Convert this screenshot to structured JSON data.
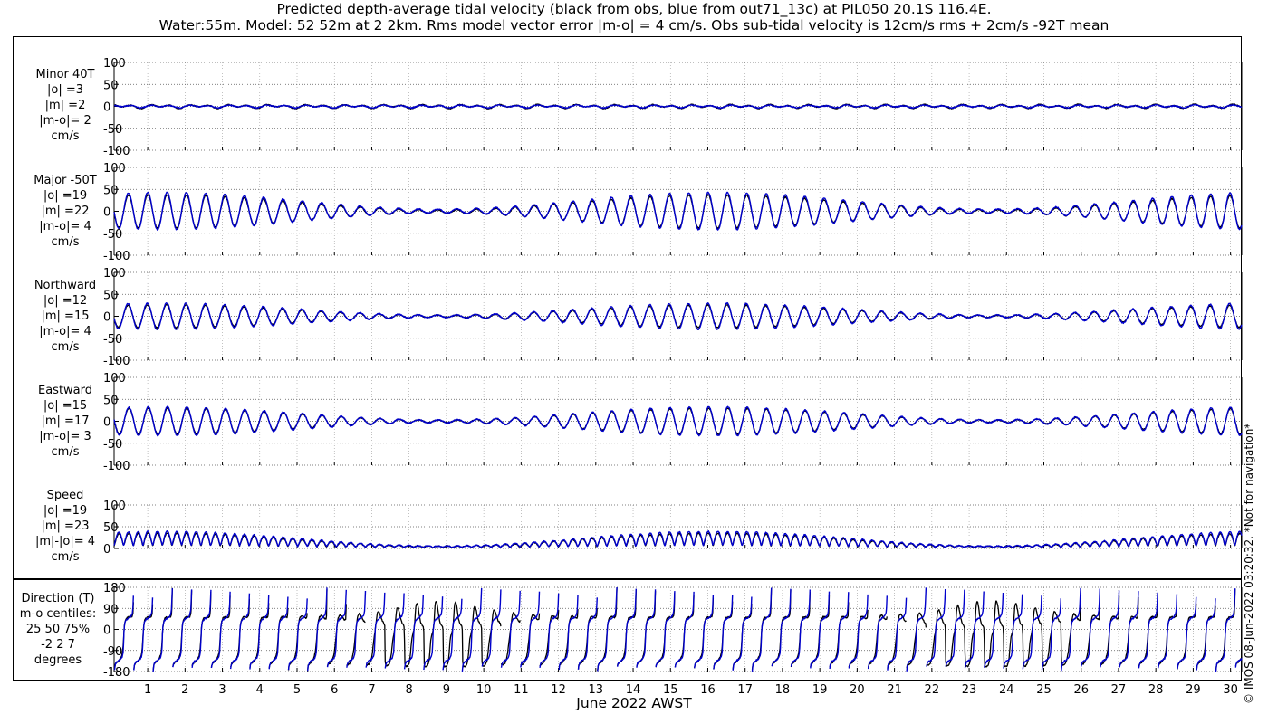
{
  "title": {
    "line1": "Predicted depth-average tidal velocity (black from obs, blue from out71_13c) at PIL050 20.1S 116.4E.",
    "line2": "Water:55m. Model: 52 52m at 2 2km. Rms model vector error |m-o| = 4 cm/s. Obs sub-tidal velocity is 12cm/s rms + 2cm/s -92T mean"
  },
  "xlabel": "June 2022 AWST",
  "credit": "© IMOS 08-Jun-2022 03:20:32. *Not for navigation*",
  "colors": {
    "obs": "#000000",
    "model": "#0000cc",
    "grid": "#999999",
    "axis": "#000000"
  },
  "chart_data": [
    {
      "type": "line",
      "panel": "minor",
      "label_lines": [
        "Minor 40T",
        "|o| =3",
        "|m| =2",
        "|m-o|= 2",
        "cm/s"
      ],
      "ylim": [
        -100,
        100
      ],
      "yticks": [
        -100,
        -50,
        0,
        50,
        100
      ],
      "xlim": [
        0.1,
        30.3
      ],
      "xticks": [
        1,
        2,
        3,
        4,
        5,
        6,
        7,
        8,
        9,
        10,
        11,
        12,
        13,
        14,
        15,
        16,
        17,
        18,
        19,
        20,
        21,
        22,
        23,
        24,
        25,
        26,
        27,
        28,
        29,
        30
      ],
      "grid": true,
      "series": [
        {
          "role": "obs",
          "stats": {
            "rms": 3
          }
        },
        {
          "role": "model",
          "stats": {
            "rms": 2
          }
        }
      ]
    },
    {
      "type": "line",
      "panel": "major",
      "label_lines": [
        "Major -50T",
        "|o| =19",
        "|m| =22",
        "|m-o|= 4",
        "cm/s"
      ],
      "ylim": [
        -100,
        100
      ],
      "yticks": [
        -100,
        -50,
        0,
        50,
        100
      ],
      "xlim": [
        0.1,
        30.3
      ],
      "grid": true,
      "series": [
        {
          "role": "obs",
          "stats": {
            "rms": 19
          }
        },
        {
          "role": "model",
          "stats": {
            "rms": 22
          }
        }
      ]
    },
    {
      "type": "line",
      "panel": "northward",
      "label_lines": [
        "Northward",
        "|o| =12",
        "|m| =15",
        "|m-o|= 4",
        "cm/s"
      ],
      "ylim": [
        -100,
        100
      ],
      "yticks": [
        -100,
        -50,
        0,
        50,
        100
      ],
      "xlim": [
        0.1,
        30.3
      ],
      "grid": true,
      "series": [
        {
          "role": "obs",
          "stats": {
            "rms": 12
          }
        },
        {
          "role": "model",
          "stats": {
            "rms": 15
          }
        }
      ]
    },
    {
      "type": "line",
      "panel": "eastward",
      "label_lines": [
        "Eastward",
        "|o| =15",
        "|m| =17",
        "|m-o|= 3",
        "cm/s"
      ],
      "ylim": [
        -100,
        100
      ],
      "yticks": [
        -100,
        -50,
        0,
        50,
        100
      ],
      "xlim": [
        0.1,
        30.3
      ],
      "grid": true,
      "series": [
        {
          "role": "obs",
          "stats": {
            "rms": 15
          }
        },
        {
          "role": "model",
          "stats": {
            "rms": 17
          }
        }
      ]
    },
    {
      "type": "line",
      "panel": "speed",
      "label_lines": [
        "Speed",
        "|o| =19",
        "|m| =23",
        "|m|-|o|= 4",
        "cm/s"
      ],
      "ylim": [
        0,
        100
      ],
      "yticks": [
        0,
        50,
        100
      ],
      "xlim": [
        0.1,
        30.3
      ],
      "grid": true,
      "series": [
        {
          "role": "obs",
          "stats": {
            "rms": 19
          }
        },
        {
          "role": "model",
          "stats": {
            "rms": 23
          }
        }
      ]
    },
    {
      "type": "line",
      "panel": "direction",
      "label_lines": [
        "Direction (T)",
        "m-o centiles:",
        "25  50  75%",
        "-2  2  7",
        "degrees"
      ],
      "ylim": [
        -180,
        180
      ],
      "yticks": [
        -180,
        -90,
        0,
        90,
        180
      ],
      "xlim": [
        0.1,
        30.3
      ],
      "grid": true,
      "series": [
        {
          "role": "obs"
        },
        {
          "role": "model"
        }
      ]
    }
  ]
}
